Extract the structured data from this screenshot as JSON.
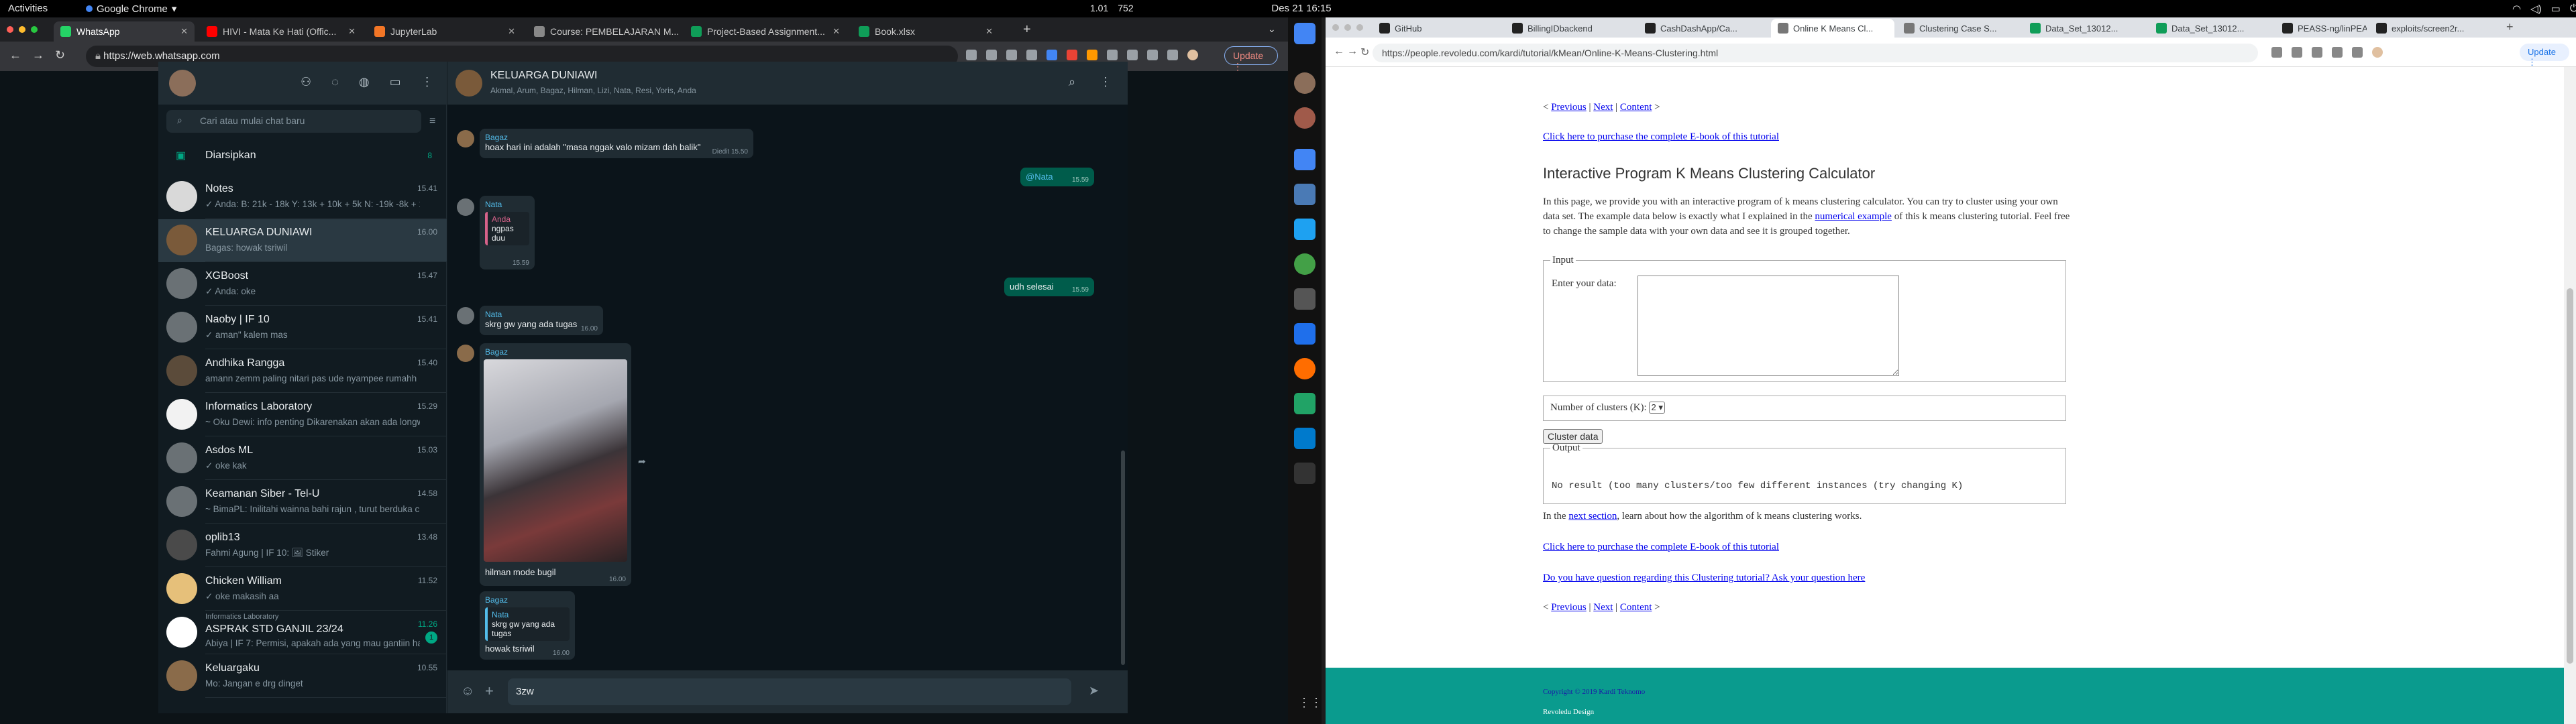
{
  "topbar": {
    "activities": "Activities",
    "app_name": "Google Chrome",
    "clock": "Des 21  16:15",
    "net_down": "1.01",
    "net_up": "752"
  },
  "left_browser": {
    "tabs": [
      {
        "label": "WhatsApp",
        "color": "#25d366",
        "active": true
      },
      {
        "label": "HIVI - Mata Ke Hati (Offic...",
        "color": "#ff0000",
        "active": false
      },
      {
        "label": "JupyterLab",
        "color": "#f37626",
        "active": false
      },
      {
        "label": "Course: PEMBELAJARAN M...",
        "color": "#888888",
        "active": false
      },
      {
        "label": "Project-Based Assignment...",
        "color": "#0f9d58",
        "active": false
      },
      {
        "label": "Book.xlsx",
        "color": "#0f9d58",
        "active": false
      }
    ],
    "url": "https://web.whatsapp.com",
    "update_label": "Update"
  },
  "whatsapp": {
    "search_placeholder": "Cari atau mulai chat baru",
    "archived_label": "Diarsipkan",
    "archived_count": "8",
    "chats": [
      {
        "name": "Notes",
        "preview": "✓ Anda: B: 21k - 18k Y: 13k + 10k + 5k N: -19k -8k + 10...",
        "time": "15.41",
        "color": "#d9d9d9"
      },
      {
        "name": "KELUARGA DUNIAWI",
        "preview": "Bagas: howak tsriwil",
        "time": "16.00",
        "color": "#7a5a3a"
      },
      {
        "name": "XGBoost",
        "preview": "✓ Anda: oke",
        "time": "15.47",
        "color": "#6a7175"
      },
      {
        "name": "Naoby | IF 10",
        "preview": "✓ aman\" kalem mas",
        "time": "15.41",
        "color": "#6a7175"
      },
      {
        "name": "Andhika Rangga",
        "preview": "amann zemm paling nitari pas ude nyampee rumahh",
        "time": "15.40",
        "color": "#5b4b3a"
      },
      {
        "name": "Informatics Laboratory",
        "preview": "~ Oku Dewi: info penting Dikarenakan akan ada longweek...",
        "time": "15.29",
        "color": "#f2f2f2"
      },
      {
        "name": "Asdos ML",
        "preview": "✓ oke kak",
        "time": "15.03",
        "color": "#6a7175"
      },
      {
        "name": "Keamanan Siber - Tel-U",
        "preview": "~ BimaPL: Inilitahi wainna bahi rajun , turut berduka cita ...",
        "time": "14.58",
        "color": "#6a7175"
      },
      {
        "name": "oplib13",
        "preview": "Fahmi Agung | IF 10: 🖼 Stiker",
        "time": "13.48",
        "color": "#4a4a4a"
      },
      {
        "name": "Chicken William",
        "preview": "✓ oke makasih aa",
        "time": "11.52",
        "color": "#e6c07a"
      },
      {
        "name": "ASPRAK STD GANJIL 23/24",
        "preview": "Abiya | IF 7: Permisi, apakah ada yang mau gantiin hari ini j...",
        "time": "11.26",
        "color": "#ffffff",
        "community": "Informatics Laboratory",
        "unread": "1"
      },
      {
        "name": "Keluargaku",
        "preview": "Mo: Jangan e drg dinget",
        "time": "10.55",
        "color": "#8a6b4a"
      }
    ],
    "group": {
      "name": "KELUARGA DUNIAWI",
      "members": "Akmal, Arum, Bagaz, Hilman, Lizi, Nata, Resi, Yoris, Anda"
    },
    "messages": {
      "m1_sender": "Bagaz",
      "m1_text": "hoax hari ini adalah \"masa nggak valo mizam dah balik\"",
      "m1_time": "Diedit  15.50",
      "m2_text": "@Nata",
      "m2_time": "15.59",
      "m3_sender": "Nata",
      "m3_quote_sender": "Anda",
      "m3_quote_text": "ngpas duu",
      "m3_time": "15.59",
      "m4_text": "udh selesai",
      "m4_time": "15.59",
      "m5_sender": "Nata",
      "m5_text": "skrg gw yang ada tugas",
      "m5_time": "16.00",
      "m6_sender": "Bagaz",
      "m6_caption": "hilman mode bugil",
      "m6_time": "16.00",
      "m7_sender": "Bagaz",
      "m7_quote_sender": "Nata",
      "m7_quote_text": "skrg gw yang ada tugas",
      "m7_text": "howak tsriwil",
      "m7_time": "16.00"
    },
    "composer_text": "3zw"
  },
  "right_browser": {
    "tabs": [
      {
        "label": "GitHub",
        "color": "#222222",
        "active": false
      },
      {
        "label": "BillingIDbackend",
        "color": "#222222",
        "active": false
      },
      {
        "label": "CashDashApp/Ca...",
        "color": "#222222",
        "active": false
      },
      {
        "label": "Online K Means Cl...",
        "color": "#777777",
        "active": true
      },
      {
        "label": "Clustering Case S...",
        "color": "#777777",
        "active": false
      },
      {
        "label": "Data_Set_13012...",
        "color": "#0f9d58",
        "active": false
      },
      {
        "label": "Data_Set_13012...",
        "color": "#0f9d58",
        "active": false
      },
      {
        "label": "PEASS-ng/linPEA...",
        "color": "#222222",
        "active": false
      },
      {
        "label": "exploits/screen2r...",
        "color": "#222222",
        "active": false
      }
    ],
    "url": "https://people.revoledu.com/kardi/tutorial/kMean/Online-K-Means-Clustering.html",
    "update_label": "Update"
  },
  "kmeans_page": {
    "nav_previous": "Previous",
    "nav_next": "Next",
    "nav_content": "Content",
    "purchase_link": "Click here to purchase the complete E-book of this tutorial",
    "title": "Interactive Program K Means Clustering Calculator",
    "intro_1": "In this page, we provide you with an interactive program of k means clustering calculator. You can try to cluster using your own data set. The example data below is exactly what I explained in the",
    "intro_link": "numerical example",
    "intro_2": "of this k means clustering tutorial. Feel free to change the sample data with your own data and see it is grouped together.",
    "input_legend": "Input",
    "data_label": "Enter your data:",
    "clusters_label": "Number of clusters (K):",
    "clusters_value": "2",
    "cluster_button": "Cluster data",
    "output_legend": "Output",
    "output_text": "No result (too many clusters/too few different instances (try changing K)",
    "next_1": "In the",
    "next_link": "next section",
    "next_2": ", learn about how the algorithm of k means clustering works.",
    "question_link": "Do you have question regarding this Clustering tutorial? Ask your question here",
    "copyright": "Copyright © 2019 Kardi Teknomo",
    "footer_brand": "Revoledu Design"
  }
}
